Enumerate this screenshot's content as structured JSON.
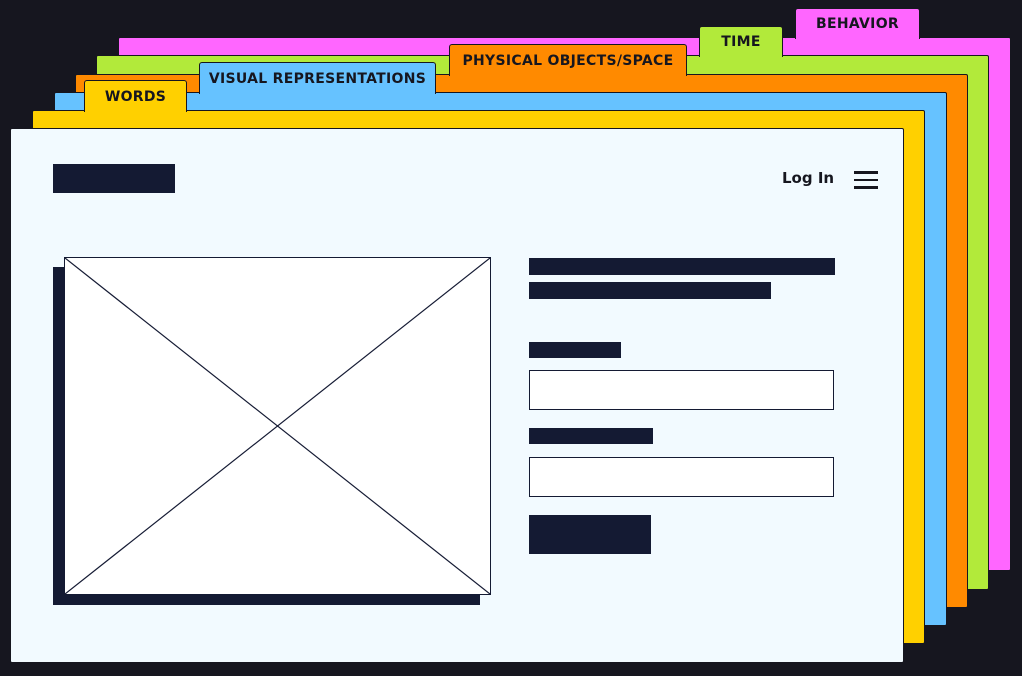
{
  "tabs": {
    "words": "WORDS",
    "visual": "VISUAL REPRESENTATIONS",
    "physical": "PHYSICAL OBJECTS/SPACE",
    "time": "TIME",
    "behavior": "BEHAVIOR"
  },
  "colors": {
    "words": "#ffd000",
    "visual": "#66c2ff",
    "physical": "#ff8a00",
    "time": "#b2ea3a",
    "behavior": "#ff66ff",
    "front": "#f2faff",
    "ink": "#141a33"
  },
  "wireframe": {
    "login_label": "Log In",
    "menu_icon": "hamburger-menu-icon",
    "image_placeholder_icon": "image-placeholder-icon"
  }
}
